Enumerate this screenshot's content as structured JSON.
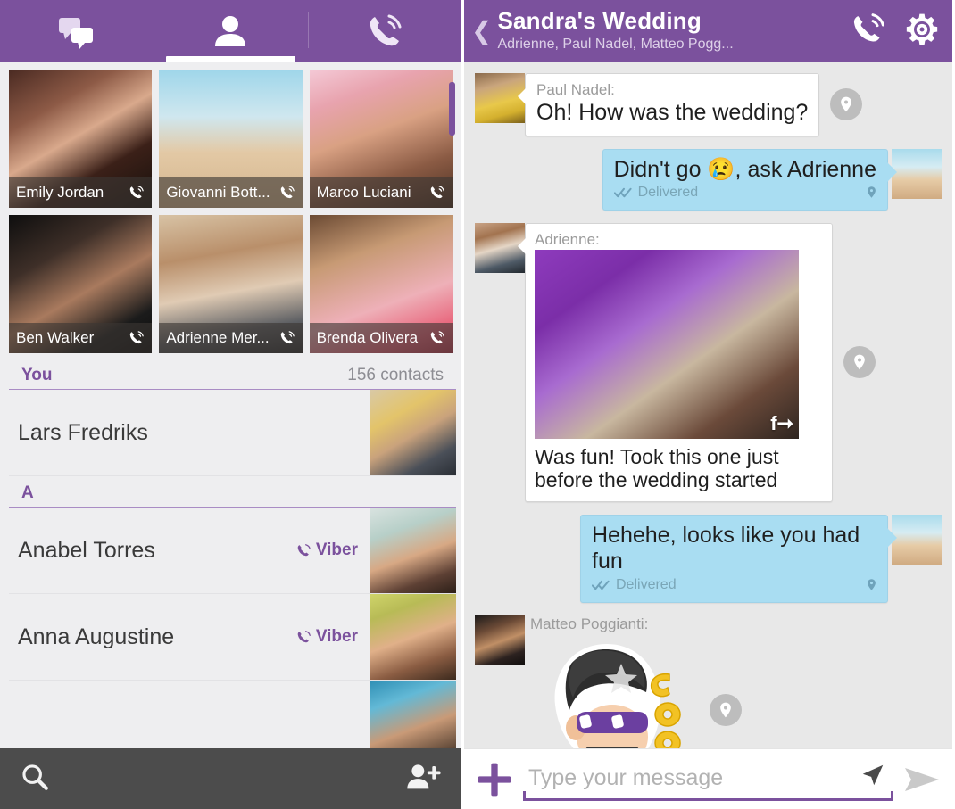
{
  "left": {
    "tabs": [
      {
        "name": "chats",
        "icon": "chat-bubbles-icon",
        "active": false
      },
      {
        "name": "contacts",
        "icon": "person-icon",
        "active": true
      },
      {
        "name": "calls",
        "icon": "phone-call-icon",
        "active": false
      }
    ],
    "favorites": [
      {
        "name": "Emily Jordan",
        "call_icon": "viber-call-icon"
      },
      {
        "name": "Giovanni Bott...",
        "call_icon": "viber-call-icon"
      },
      {
        "name": "Marco Luciani",
        "call_icon": "viber-call-icon"
      },
      {
        "name": "Ben Walker",
        "call_icon": "viber-call-icon"
      },
      {
        "name": "Adrienne Mer...",
        "call_icon": "viber-call-icon"
      },
      {
        "name": "Brenda Olivera",
        "call_icon": "viber-call-icon"
      }
    ],
    "sections": [
      {
        "label": "You",
        "count": "156 contacts"
      },
      {
        "label": "A",
        "count": ""
      }
    ],
    "contacts": [
      {
        "name": "Lars Fredriks",
        "badge": ""
      },
      {
        "name": "Anabel Torres",
        "badge": "Viber"
      },
      {
        "name": "Anna Augustine",
        "badge": "Viber"
      }
    ],
    "bottom": {
      "search_icon": "search-icon",
      "add_contact_icon": "add-contact-icon"
    }
  },
  "right": {
    "header": {
      "back_icon": "back-chevron-icon",
      "title": "Sandra's Wedding",
      "subtitle": "Adrienne, Paul Nadel, Matteo Pogg...",
      "call_icon": "viber-call-icon",
      "settings_icon": "gear-icon"
    },
    "messages": [
      {
        "type": "text",
        "direction": "in",
        "sender": "Paul Nadel:",
        "text": "Oh! How was the wedding?",
        "location_pin": "location-pin-icon"
      },
      {
        "type": "text",
        "direction": "out",
        "sender": "",
        "text": "Didn't go 😢, ask Adrienne",
        "status": "Delivered",
        "status_icon": "double-check-icon",
        "location_pin": "location-pin-icon"
      },
      {
        "type": "photo",
        "direction": "in",
        "sender": "Adrienne:",
        "caption": "Was fun! Took this one just before the wedding started",
        "share_icon": "facebook-share-icon",
        "location_pin": "location-pin-icon"
      },
      {
        "type": "text",
        "direction": "out",
        "sender": "",
        "text": "Hehehe, looks like you had fun",
        "status": "Delivered",
        "status_icon": "double-check-icon",
        "location_pin": "location-pin-icon"
      },
      {
        "type": "sticker",
        "direction": "in",
        "sender": "Matteo Poggianti:",
        "sticker_name": "cool-guy-sunglasses-sticker",
        "location_pin": "location-pin-icon"
      }
    ],
    "input": {
      "add_icon": "plus-icon",
      "placeholder": "Type your message",
      "location_icon": "location-arrow-icon",
      "send_icon": "send-arrow-icon"
    }
  },
  "colors": {
    "brand_purple": "#7b519d",
    "bubble_blue": "#a9ddf2",
    "bubble_white": "#ffffff",
    "chat_bg": "#e8e8e8",
    "bottom_bar": "#4c4c4c"
  }
}
